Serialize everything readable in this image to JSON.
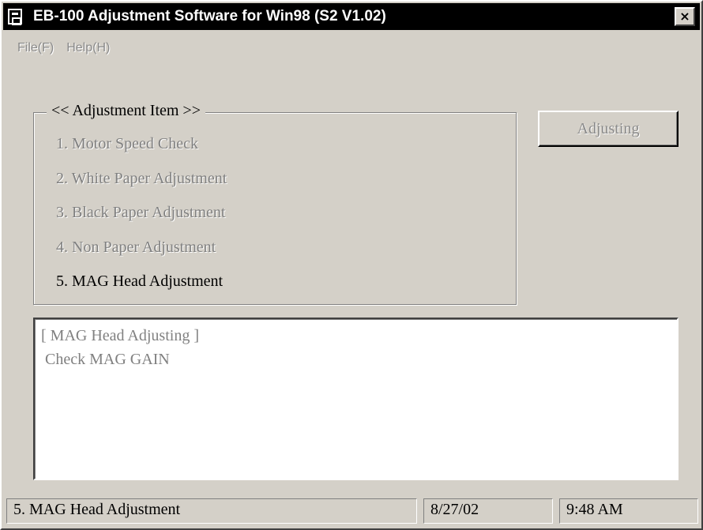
{
  "window": {
    "title": "EB-100 Adjustment Software for Win98 (S2 V1.02)",
    "close_label": "×",
    "icon": "app-icon"
  },
  "menu": [
    {
      "label": "File(F)"
    },
    {
      "label": "Help(H)"
    }
  ],
  "adjustment_group": {
    "title": "<< Adjustment Item >>",
    "items": [
      {
        "label": "1. Motor Speed Check",
        "active": false
      },
      {
        "label": "2. White Paper Adjustment",
        "active": false
      },
      {
        "label": "3. Black Paper Adjustment",
        "active": false
      },
      {
        "label": "4. Non Paper Adjustment",
        "active": false
      },
      {
        "label": "5. MAG Head Adjustment",
        "active": true
      }
    ]
  },
  "adjust_button": {
    "label": "Adjusting",
    "enabled": false
  },
  "output": {
    "lines": [
      "[ MAG Head Adjusting ]",
      " Check MAG GAIN"
    ]
  },
  "status_bar": {
    "message": "5. MAG Head Adjustment",
    "date": "8/27/02",
    "time": "9:48 AM"
  },
  "colors": {
    "face": "#d4d0c8",
    "title_bar": "#000000",
    "disabled_text": "#808080"
  }
}
